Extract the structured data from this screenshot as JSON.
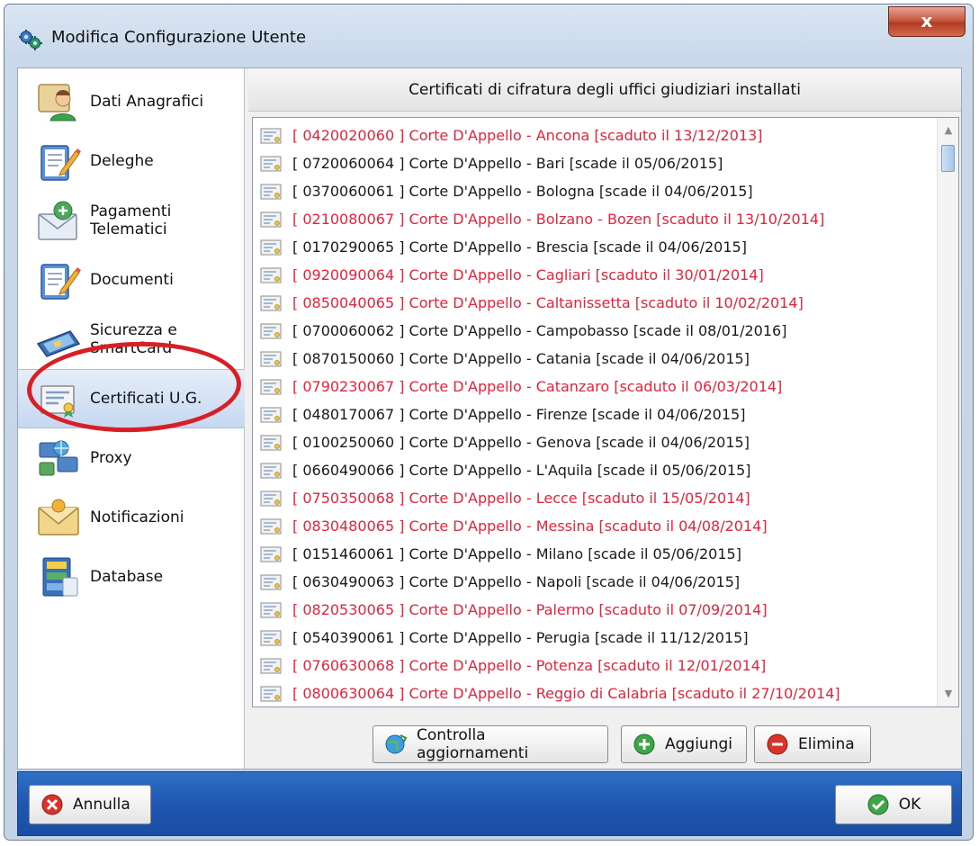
{
  "window": {
    "title": "Modifica Configurazione Utente",
    "close_label": "x"
  },
  "sidebar": {
    "items": [
      {
        "label": "Dati Anagrafici",
        "icon": "user-card-icon"
      },
      {
        "label": "Deleghe",
        "icon": "document-pencil-icon"
      },
      {
        "label": "Pagamenti\nTelematici",
        "icon": "envelope-payment-icon"
      },
      {
        "label": "Documenti",
        "icon": "document-pencil-icon"
      },
      {
        "label": "Sicurezza e\nSmartCard",
        "icon": "smartcard-icon"
      },
      {
        "label": "Certificati U.G.",
        "icon": "certificate-icon",
        "active": true
      },
      {
        "label": "Proxy",
        "icon": "network-icon"
      },
      {
        "label": "Notificazioni",
        "icon": "envelope-icon"
      },
      {
        "label": "Database",
        "icon": "database-icon"
      }
    ]
  },
  "panel": {
    "title": "Certificati di cifratura degli uffici giudiziari installati",
    "certificates": [
      {
        "text": "[ 0420020060 ] Corte D'Appello - Ancona [scaduto il 13/12/2013]",
        "status": "expired"
      },
      {
        "text": "[ 0720060064 ] Corte D'Appello - Bari [scade il 05/06/2015]",
        "status": "valid"
      },
      {
        "text": "[ 0370060061 ] Corte D'Appello - Bologna [scade il 04/06/2015]",
        "status": "valid"
      },
      {
        "text": "[ 0210080067 ] Corte D'Appello - Bolzano - Bozen [scaduto il 13/10/2014]",
        "status": "expired"
      },
      {
        "text": "[ 0170290065 ] Corte D'Appello - Brescia [scade il 04/06/2015]",
        "status": "valid"
      },
      {
        "text": "[ 0920090064 ] Corte D'Appello - Cagliari [scaduto il 30/01/2014]",
        "status": "expired"
      },
      {
        "text": "[ 0850040065 ] Corte D'Appello - Caltanissetta [scaduto il 10/02/2014]",
        "status": "expired"
      },
      {
        "text": "[ 0700060062 ] Corte D'Appello - Campobasso [scade il 08/01/2016]",
        "status": "valid"
      },
      {
        "text": "[ 0870150060 ] Corte D'Appello - Catania [scade il 04/06/2015]",
        "status": "valid"
      },
      {
        "text": "[ 0790230067 ] Corte D'Appello - Catanzaro [scaduto il 06/03/2014]",
        "status": "expired"
      },
      {
        "text": "[ 0480170067 ] Corte D'Appello - Firenze [scade il 04/06/2015]",
        "status": "valid"
      },
      {
        "text": "[ 0100250060 ] Corte D'Appello - Genova [scade il 04/06/2015]",
        "status": "valid"
      },
      {
        "text": "[ 0660490066 ] Corte D'Appello - L'Aquila [scade il 05/06/2015]",
        "status": "valid"
      },
      {
        "text": "[ 0750350068 ] Corte D'Appello - Lecce [scaduto il 15/05/2014]",
        "status": "expired"
      },
      {
        "text": "[ 0830480065 ] Corte D'Appello - Messina [scaduto il 04/08/2014]",
        "status": "expired"
      },
      {
        "text": "[ 0151460061 ] Corte D'Appello - Milano [scade il 05/06/2015]",
        "status": "valid"
      },
      {
        "text": "[ 0630490063 ] Corte D'Appello - Napoli [scade il 04/06/2015]",
        "status": "valid"
      },
      {
        "text": "[ 0820530065 ] Corte D'Appello - Palermo [scaduto il 07/09/2014]",
        "status": "expired"
      },
      {
        "text": "[ 0540390061 ] Corte D'Appello - Perugia [scade il 11/12/2015]",
        "status": "valid"
      },
      {
        "text": "[ 0760630068 ] Corte D'Appello - Potenza [scaduto il 12/01/2014]",
        "status": "expired"
      },
      {
        "text": "[ 0800630064 ] Corte D'Appello - Reggio di Calabria [scaduto il 27/10/2014]",
        "status": "expired"
      }
    ],
    "buttons": {
      "check_updates": "Controlla aggiornamenti",
      "add": "Aggiungi",
      "delete": "Elimina"
    }
  },
  "footer": {
    "cancel": "Annulla",
    "ok": "OK"
  },
  "colors": {
    "expired": "#e8223b",
    "valid": "#1a1a1a",
    "footer": "#1f57b0",
    "annotation": "#d81f26"
  },
  "annotation": {
    "shape": "red-oval",
    "target": "Certificati U.G."
  }
}
